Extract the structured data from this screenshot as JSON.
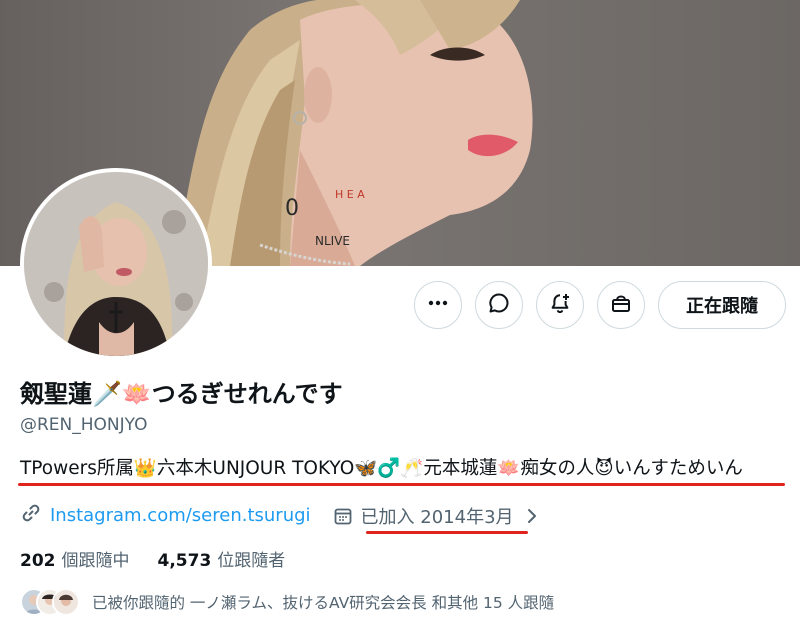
{
  "profile": {
    "display_name": "剱聖蓮🗡️🪷つるぎせれんです",
    "handle": "@REN_HONJYO",
    "bio": "TPowers所属👑六本木UNJOUR TOKYO🦋♂️🥂元本城蓮🪷痴女の人😈いんすためいん",
    "link": "Instagram.com/seren.tsurugi",
    "joined": "已加入 2014年3月",
    "following_count": "202",
    "following_label": "個跟隨中",
    "followers_count": "4,573",
    "followers_label": "位跟隨者",
    "followed_by": "已被你跟隨的 一ノ瀬ラム、抜けるAV研究会会長 和其他 15 人跟隨"
  },
  "actions": {
    "more_icon": "more-icon",
    "message_icon": "message-icon",
    "notify_icon": "bell-plus-icon",
    "gift_icon": "gift-icon",
    "follow_label": "正在跟隨"
  },
  "colors": {
    "link": "#1d9bf0",
    "secondary_text": "#536471",
    "annotation_red": "#e0231c",
    "button_border": "#cfd9de"
  }
}
